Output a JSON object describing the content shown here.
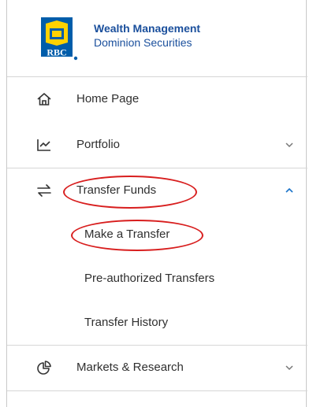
{
  "brand": {
    "logo_text": "RBC",
    "line1": "Wealth Management",
    "line2": "Dominion Securities",
    "colors": {
      "primary": "#005daa",
      "accent": "#ffd200",
      "text": "#1a4f9c"
    }
  },
  "nav": {
    "home": {
      "label": "Home Page",
      "icon": "home-icon"
    },
    "portfolio": {
      "label": "Portfolio",
      "icon": "chart-line-icon",
      "expanded": false
    },
    "transfer": {
      "label": "Transfer Funds",
      "icon": "transfer-arrows-icon",
      "expanded": true,
      "children": [
        {
          "label": "Make a Transfer"
        },
        {
          "label": "Pre-authorized Transfers"
        },
        {
          "label": "Transfer History"
        }
      ]
    },
    "markets": {
      "label": "Markets & Research",
      "icon": "pie-chart-icon",
      "expanded": false
    }
  },
  "annotation_color": "#d81e1e"
}
